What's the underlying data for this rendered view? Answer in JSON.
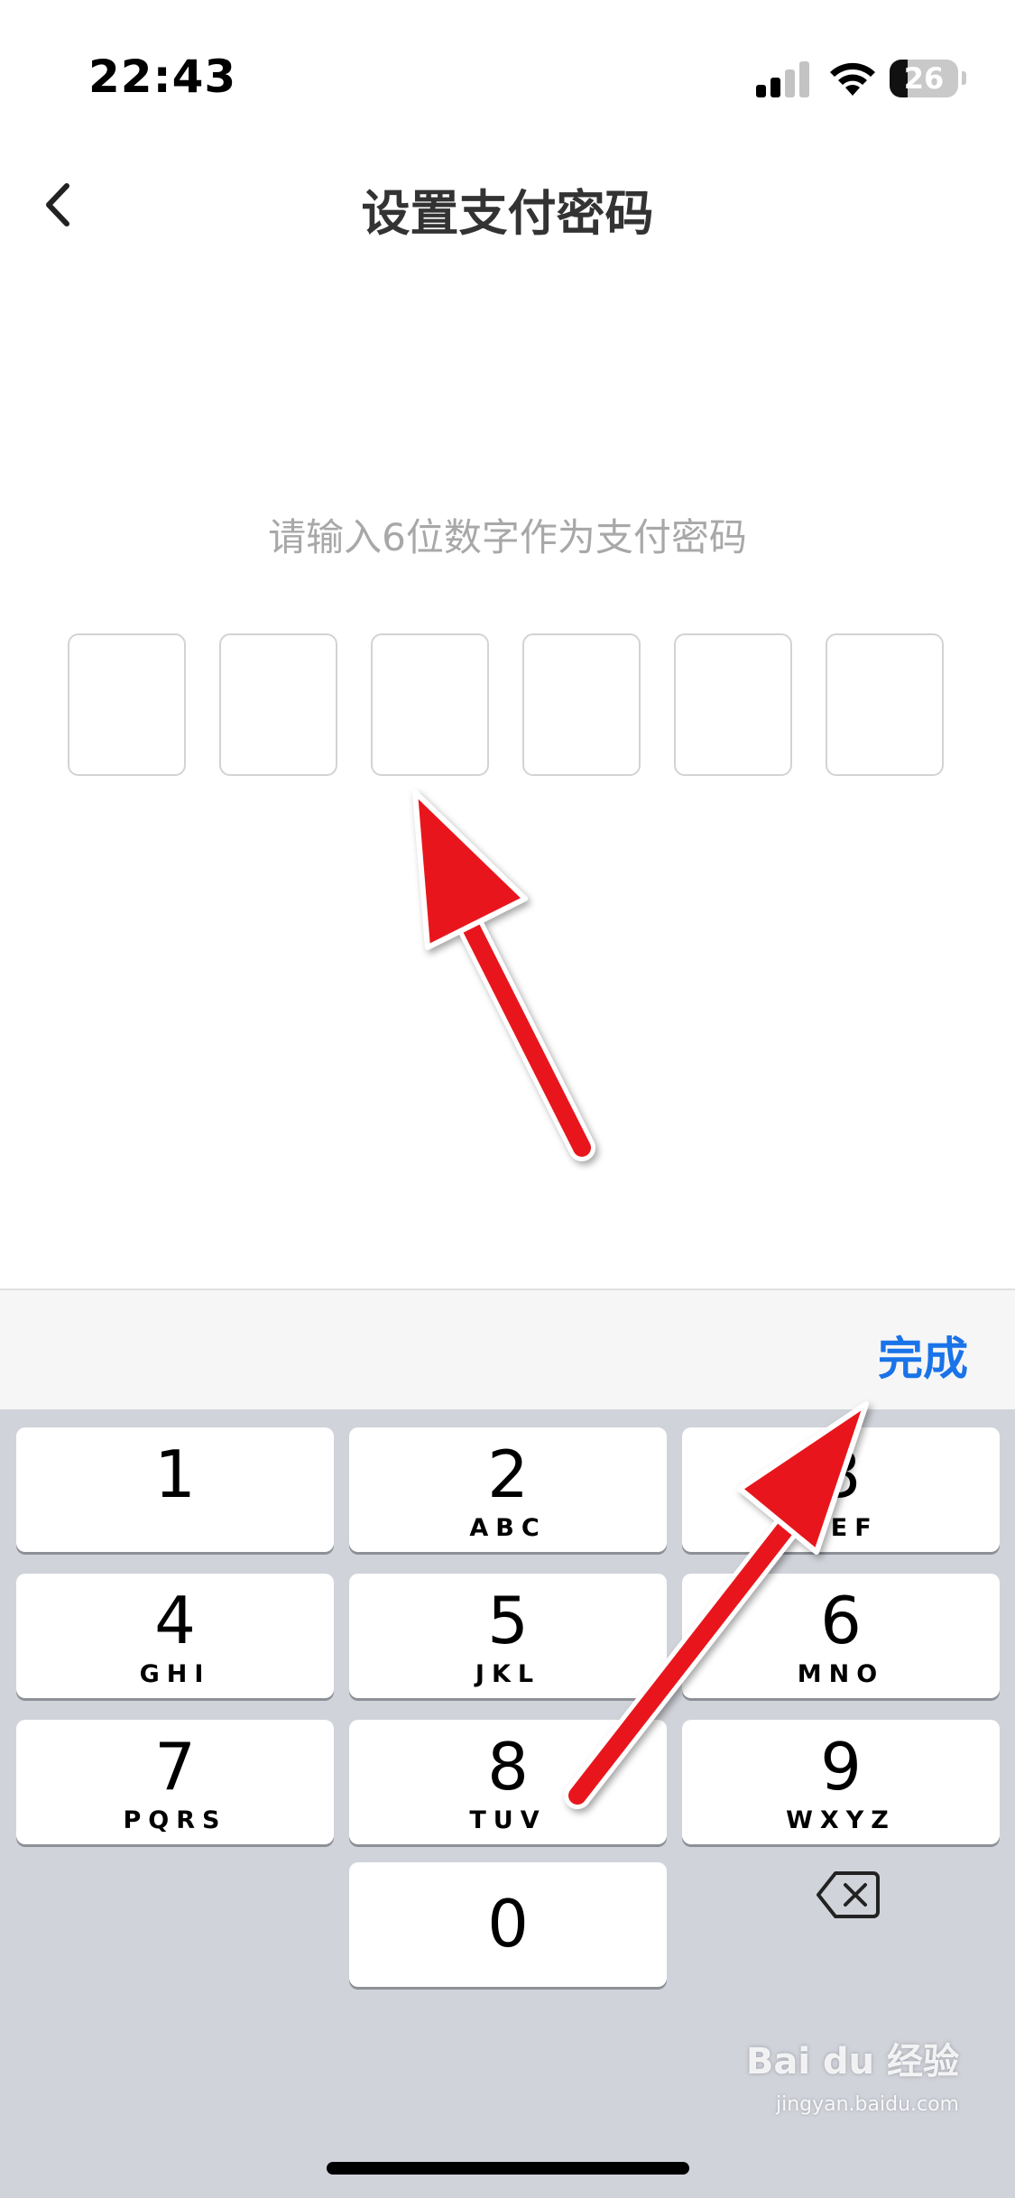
{
  "status_bar": {
    "time": "22:43",
    "battery_level": "26",
    "battery_fraction": 0.26,
    "signal_bars_active": 2,
    "signal_bars_total": 4
  },
  "nav": {
    "title": "设置支付密码",
    "back_icon": "chevron-left-icon"
  },
  "prompt": "请输入6位数字作为支付密码",
  "code_boxes": [
    "",
    "",
    "",
    "",
    "",
    ""
  ],
  "keyboard": {
    "done_label": "完成",
    "done_color": "#1a73e8",
    "keys": [
      {
        "digit": "1",
        "letters": ""
      },
      {
        "digit": "2",
        "letters": "ABC"
      },
      {
        "digit": "3",
        "letters": "DEF"
      },
      {
        "digit": "4",
        "letters": "GHI"
      },
      {
        "digit": "5",
        "letters": "JKL"
      },
      {
        "digit": "6",
        "letters": "MNO"
      },
      {
        "digit": "7",
        "letters": "PQRS"
      },
      {
        "digit": "8",
        "letters": "TUV"
      },
      {
        "digit": "9",
        "letters": "WXYZ"
      },
      {
        "digit": "0",
        "letters": ""
      }
    ],
    "backspace_icon": "backspace-icon"
  },
  "watermark": {
    "brand": "Bai du 经验",
    "url": "jingyan.baidu.com"
  },
  "annotation_color": "#e8161d"
}
